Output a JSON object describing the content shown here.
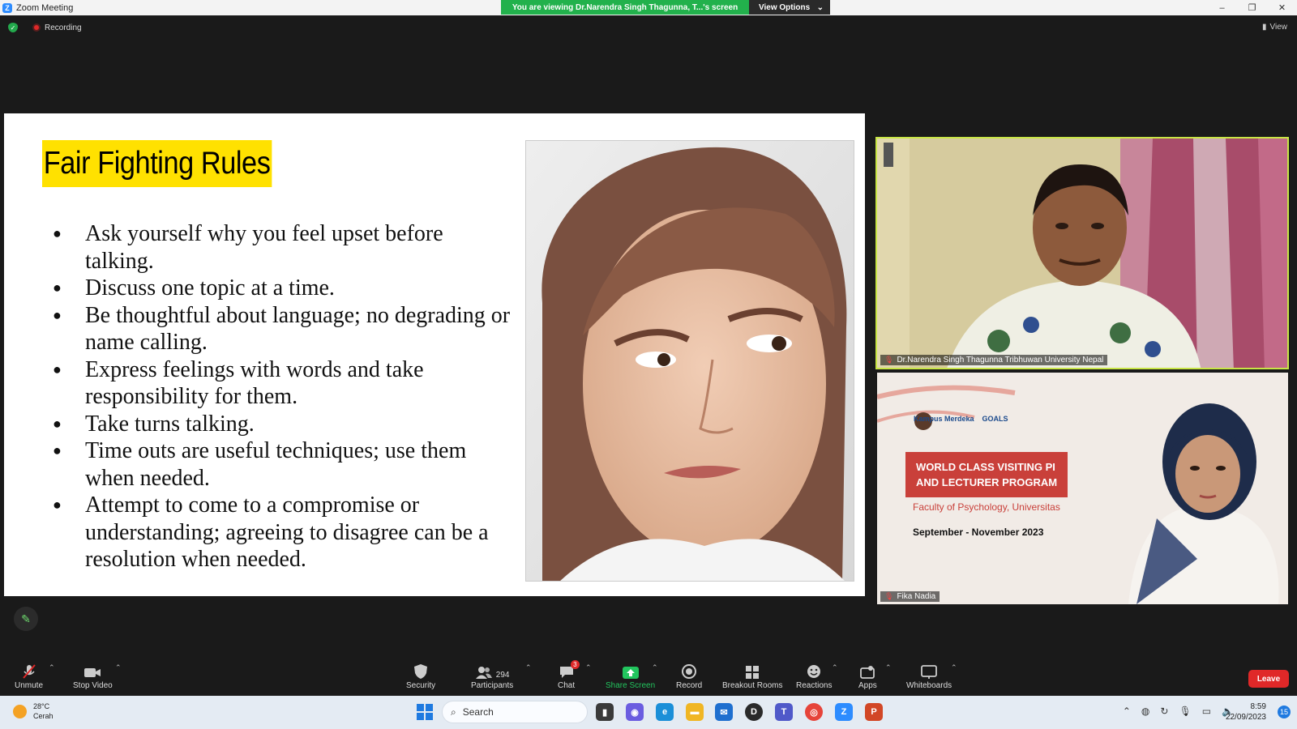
{
  "window": {
    "title": "Zoom Meeting",
    "logo": "Z",
    "controls": [
      "–",
      "❐",
      "✕"
    ]
  },
  "share_banner": {
    "text": "You are viewing Dr.Narendra Singh Thagunna,  T...'s screen",
    "view_options": "View Options"
  },
  "meeting_status": {
    "recording": "Recording",
    "view": "View"
  },
  "slide": {
    "title": "Fair Fighting Rules",
    "bullets": [
      "Ask yourself why you feel upset before talking.",
      "Discuss one topic at a time.",
      "Be thoughtful about language; no degrading or name calling.",
      "Express feelings with words and take responsibility for them.",
      "Take turns talking.",
      "Time outs are useful techniques; use them when needed.",
      "Attempt to come to a compromise or understanding; agreeing to disagree can be a resolution when needed."
    ]
  },
  "participants_video": [
    {
      "name": "Dr.Narendra Singh Thagunna  Tribhuwan University Nepal"
    },
    {
      "name": "Fika Nadia",
      "poster": {
        "logo_text": "Kampus Merdeka",
        "logo_goals": "GOALS",
        "banner_line1": "WORLD CLASS VISITING PI",
        "banner_line2": "AND LECTURER PROGRAM",
        "faculty": "Faculty of Psychology, Universitas",
        "dates": "September - November 2023"
      }
    }
  ],
  "toolbar": {
    "unmute": "Unmute",
    "stop_video": "Stop Video",
    "security": "Security",
    "participants": "Participants",
    "participants_count": "294",
    "chat": "Chat",
    "chat_badge": "3",
    "share_screen": "Share Screen",
    "record": "Record",
    "breakout_rooms": "Breakout Rooms",
    "reactions": "Reactions",
    "apps": "Apps",
    "whiteboards": "Whiteboards",
    "leave": "Leave"
  },
  "taskbar": {
    "temperature": "28°C",
    "weather": "Cerah",
    "search": "Search",
    "time": "8:59",
    "date": "22/09/2023",
    "notification_count": "15"
  },
  "colors": {
    "share_green": "#22b14c",
    "slide_highlight": "#ffe100",
    "leave_red": "#e02828",
    "active_speaker_border": "#c8e645"
  }
}
